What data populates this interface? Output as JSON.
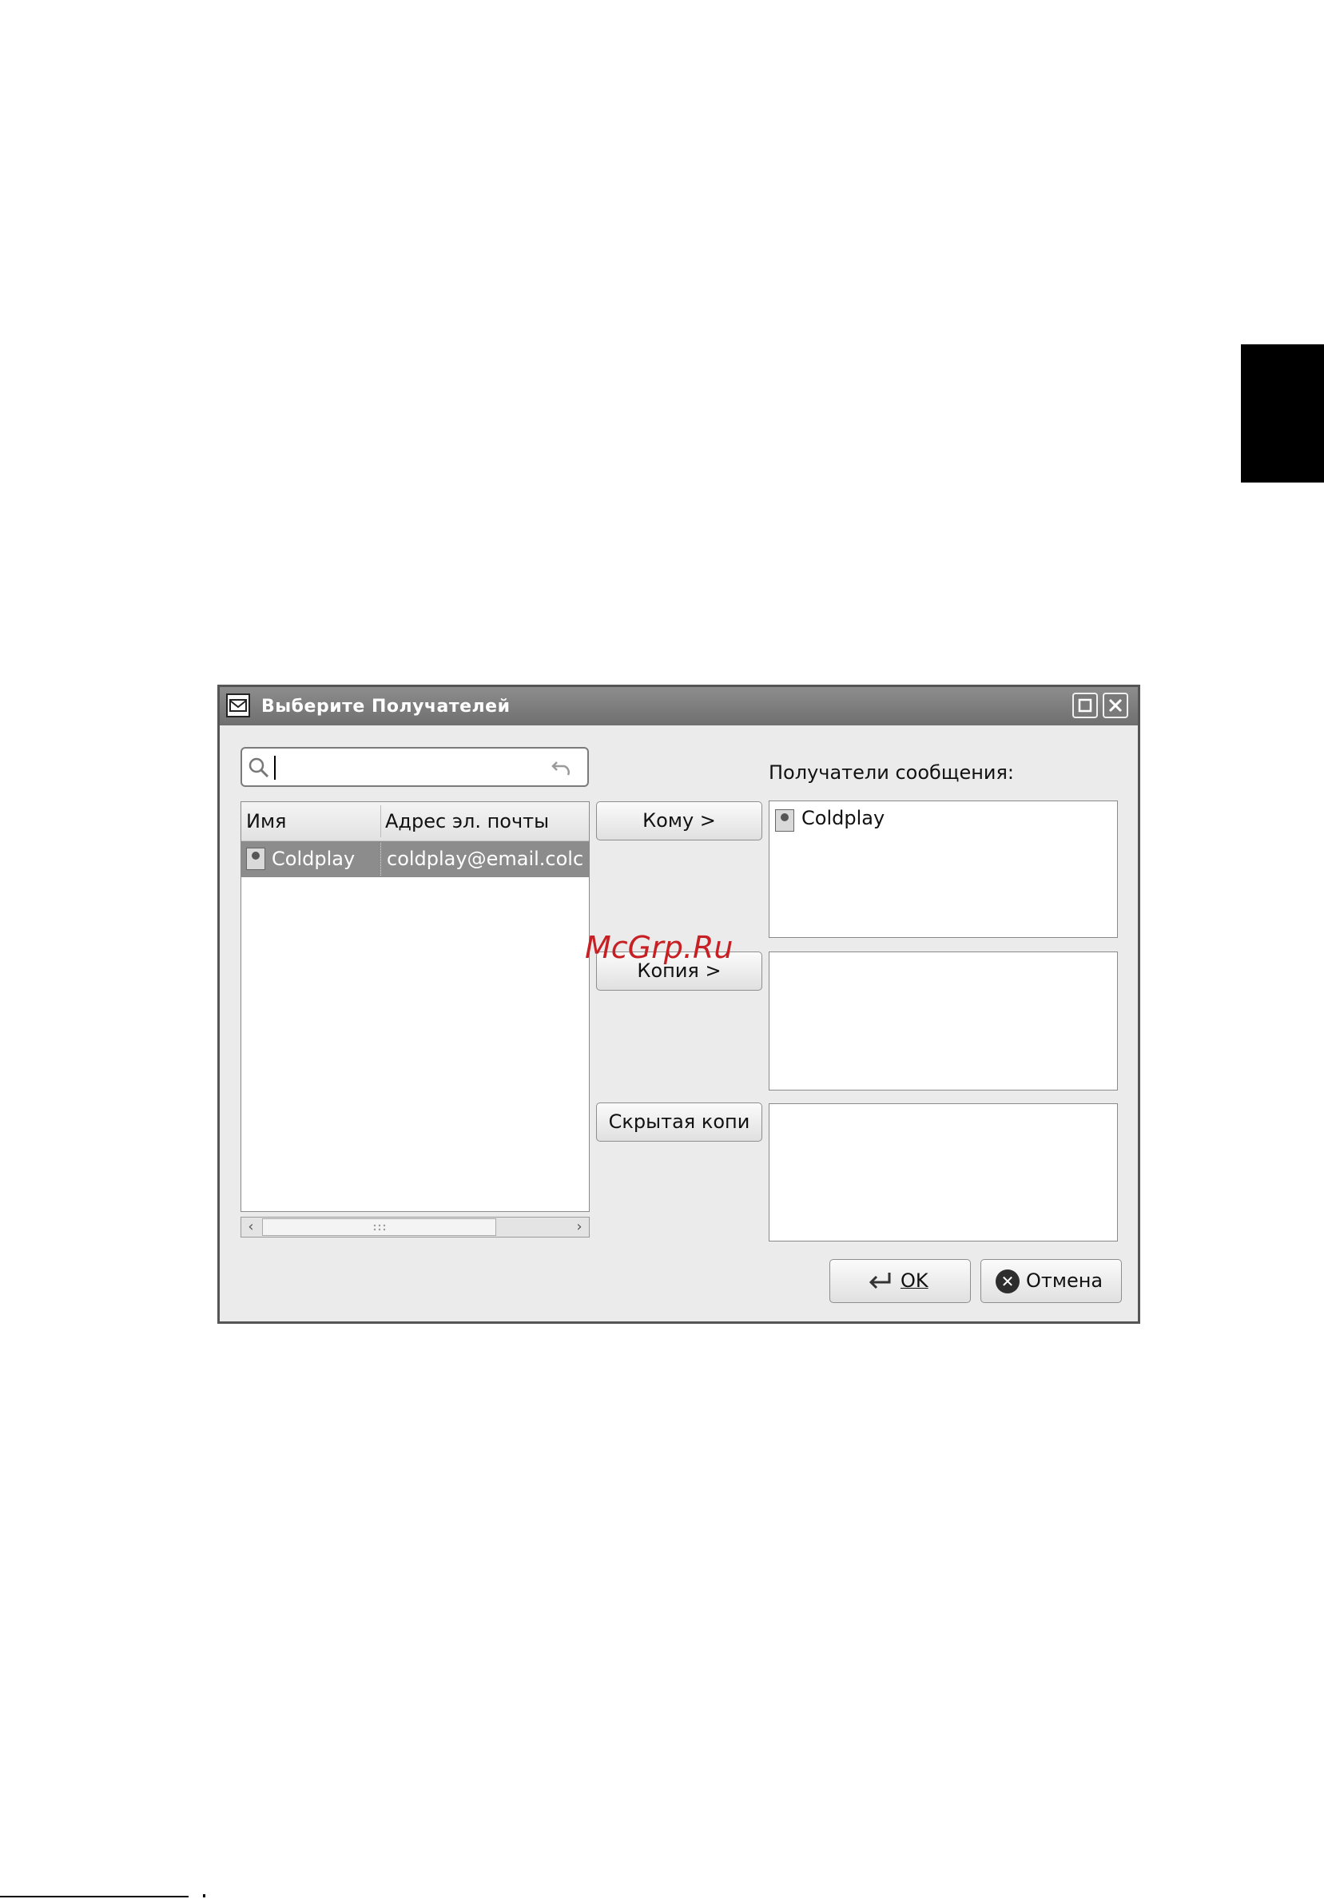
{
  "dialog": {
    "title": "Выберите Получателей",
    "search": {
      "value": "",
      "placeholder": ""
    },
    "contacts": {
      "columns": [
        "Имя",
        "Адрес эл. почты"
      ],
      "rows": [
        {
          "name": "Coldplay",
          "email": "coldplay@email.colc"
        }
      ]
    },
    "buttons": {
      "to": "Кому  >",
      "cc": "Копия  >",
      "bcc": "Скрытая копи",
      "ok": "OK",
      "cancel": "Отмена"
    },
    "recipients": {
      "label": "Получатели сообщения:",
      "to": [
        "Coldplay"
      ]
    }
  },
  "watermark": "McGrp.Ru"
}
